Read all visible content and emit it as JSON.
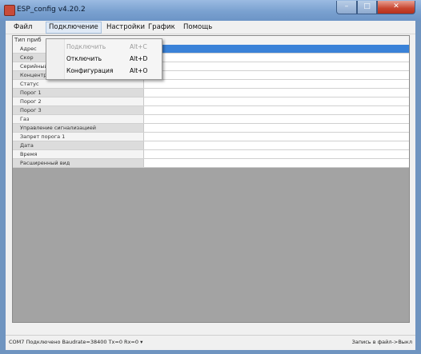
{
  "window": {
    "title": "ESP_config v4.20.2"
  },
  "menu": {
    "items": [
      {
        "label": "Файл"
      },
      {
        "label": "Подключение"
      },
      {
        "label": "Настройки"
      },
      {
        "label": "График"
      },
      {
        "label": "Помощь"
      }
    ]
  },
  "connection_menu": {
    "items": [
      {
        "label": "Подключить",
        "shortcut": "Alt+C",
        "disabled": true
      },
      {
        "label": "Отключить",
        "shortcut": "Alt+D",
        "disabled": false
      },
      {
        "label": "Конфигурация",
        "shortcut": "Alt+O",
        "disabled": false
      }
    ]
  },
  "grid": {
    "header": "Тип приб",
    "rows": [
      {
        "name": "Адрес",
        "selected": true
      },
      {
        "name": "Скор"
      },
      {
        "name": "Серийный номер"
      },
      {
        "name": "Концентрация"
      },
      {
        "name": "Статус"
      },
      {
        "name": "Порог 1"
      },
      {
        "name": "Порог 2"
      },
      {
        "name": "Порог 3"
      },
      {
        "name": "Газ"
      },
      {
        "name": "Управление сигнализацией"
      },
      {
        "name": "Запрет порога 1"
      },
      {
        "name": "Дата"
      },
      {
        "name": "Время"
      },
      {
        "name": "Расширенный вид"
      }
    ]
  },
  "status": {
    "left": "COM7 Подключено Baudrate=38400 Tx=0 Rx=0  ▾",
    "right": "Запись в файл->Выкл"
  }
}
